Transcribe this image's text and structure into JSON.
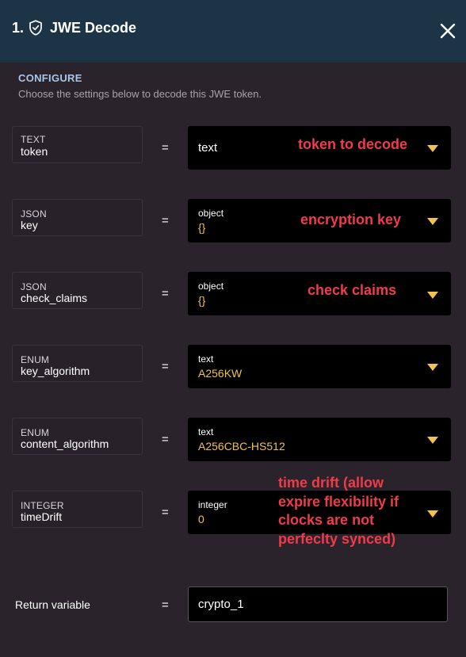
{
  "header": {
    "step": "1.",
    "title": "JWE Decode"
  },
  "configure": {
    "title": "CONFIGURE",
    "description": "Choose the settings below to decode this JWE token."
  },
  "equals": "=",
  "params": [
    {
      "type": "TEXT",
      "name": "token",
      "value_type": "",
      "value": "text",
      "annotation": "token to decode"
    },
    {
      "type": "JSON",
      "name": "key",
      "value_type": "object",
      "value": "{}",
      "annotation": "encryption key"
    },
    {
      "type": "JSON",
      "name": "check_claims",
      "value_type": "object",
      "value": "{}",
      "annotation": "check claims"
    },
    {
      "type": "ENUM",
      "name": "key_algorithm",
      "value_type": "text",
      "value": "A256KW",
      "annotation": ""
    },
    {
      "type": "ENUM",
      "name": "content_algorithm",
      "value_type": "text",
      "value": "A256CBC-HS512",
      "annotation": ""
    },
    {
      "type": "INTEGER",
      "name": "timeDrift",
      "value_type": "integer",
      "value": "0",
      "annotation": ""
    }
  ],
  "time_drift_note": [
    "time drift (allow",
    "expire flexibility if",
    "clocks are not",
    "perfeclty synced)"
  ],
  "return_variable": {
    "label": "Return variable",
    "value": "crypto_1"
  },
  "colors": {
    "header_bg": "#1d3447",
    "body_bg": "#2a232c",
    "value_text": "#f2c14e",
    "annotation": "#ef3b4a",
    "section_title": "#a9c6e6"
  }
}
